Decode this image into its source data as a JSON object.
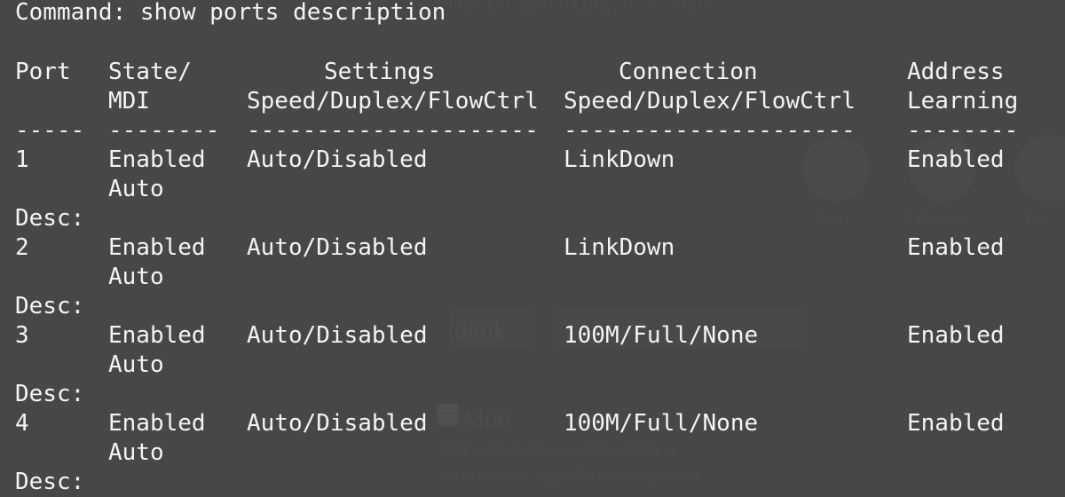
{
  "terminal": {
    "background_color": "#474747",
    "text_color": "#f4f4f2",
    "command_line": "Command: show ports description",
    "column_header_rows": [
      {
        "port": "Port",
        "state_mdi": "State/",
        "settings": "Settings",
        "connection": "Connection",
        "address": "Address"
      },
      {
        "port": "",
        "state_mdi": "MDI",
        "settings": "Speed/Duplex/FlowCtrl",
        "connection": "Speed/Duplex/FlowCtrl",
        "address": "Learning"
      }
    ],
    "separator_row": {
      "port": "-----",
      "state_mdi": "--------",
      "settings": "---------------------",
      "connection": "---------------------",
      "address": "--------"
    },
    "desc_label": "Desc:",
    "ports": [
      {
        "port": "1",
        "state": "Enabled",
        "mdi": "Auto",
        "settings": "Auto/Disabled",
        "connection": "LinkDown",
        "address_learning": "Enabled",
        "description": ""
      },
      {
        "port": "2",
        "state": "Enabled",
        "mdi": "Auto",
        "settings": "Auto/Disabled",
        "connection": "LinkDown",
        "address_learning": "Enabled",
        "description": ""
      },
      {
        "port": "3",
        "state": "Enabled",
        "mdi": "Auto",
        "settings": "Auto/Disabled",
        "connection": "100M/Full/None",
        "address_learning": "Enabled",
        "description": ""
      },
      {
        "port": "4",
        "state": "Enabled",
        "mdi": "Auto",
        "settings": "Auto/Disabled",
        "connection": "100M/Full/None",
        "address_learning": "Enabled",
        "description": ""
      }
    ]
  },
  "background_watermarks": {
    "top_line": "Начальная, назад - все анонс.",
    "brand": "dlink",
    "label": "Moe",
    "chip_labels": [
      "Тема",
      "Избранное",
      "Ещё"
    ],
    "faint_body_lines": [
      "Нажмите на ссылку, чтобы открыть",
      "и посмотреть подробную информацию"
    ]
  }
}
